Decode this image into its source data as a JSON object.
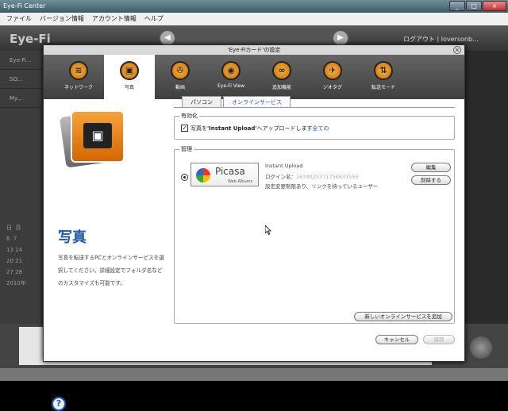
{
  "window": {
    "title": "Eye-Fi Center",
    "controls": [
      "_",
      "□",
      "×"
    ]
  },
  "menu": [
    "ファイル",
    "バージョン情報",
    "アカウント情報",
    "ヘルプ"
  ],
  "app": {
    "logo": "Eye-Fi",
    "account": "ログアウト | loversonb...",
    "sidebar": [
      "Eye-Fi...",
      "SO...",
      "My..."
    ],
    "calendar": {
      "days": [
        "日",
        "月"
      ],
      "dates": [
        "6",
        "7",
        "13",
        "14",
        "20",
        "21",
        "27",
        "28"
      ],
      "year": "2010年"
    }
  },
  "dialog": {
    "title": "'Eye-Fiカード'の設定",
    "tabs": [
      {
        "label": "ネットワーク",
        "icon": "network-icon"
      },
      {
        "label": "写真",
        "icon": "photo-icon"
      },
      {
        "label": "動画",
        "icon": "video-icon"
      },
      {
        "label": "Eye-Fi View",
        "icon": "eyefi-view-icon"
      },
      {
        "label": "追加機能",
        "icon": "binoculars-icon"
      },
      {
        "label": "ジオタグ",
        "icon": "geotag-icon"
      },
      {
        "label": "転送モード",
        "icon": "transfer-mode-icon"
      }
    ],
    "left_title": "写真",
    "left_desc": "写真を転送するPCとオンラインサービスを選択してください。詳細設定でフォルダ名などのカスタマイズも可能です。",
    "help": "?",
    "subtabs": [
      "パソコン",
      "オンラインサービス"
    ],
    "enable": {
      "caption": "有効化",
      "checked": true,
      "pre": "写真を",
      "bold": "'Instant Upload'",
      "post": "へアップロードします",
      "link": "全ての"
    },
    "manage": {
      "caption": "管理",
      "service": {
        "logo_text": "Picasa",
        "logo_sub": "Web Albums",
        "name": "Instant Upload",
        "login_label": "ログイン名：",
        "login_value": "1679025771756637555",
        "note": "設定変更制限あり、リンクを持っているユーザー"
      },
      "edit": "編集",
      "delete": "削除する",
      "add": "新しいオンラインサービスを追加"
    },
    "cancel": "キャンセル",
    "save": "保存"
  }
}
